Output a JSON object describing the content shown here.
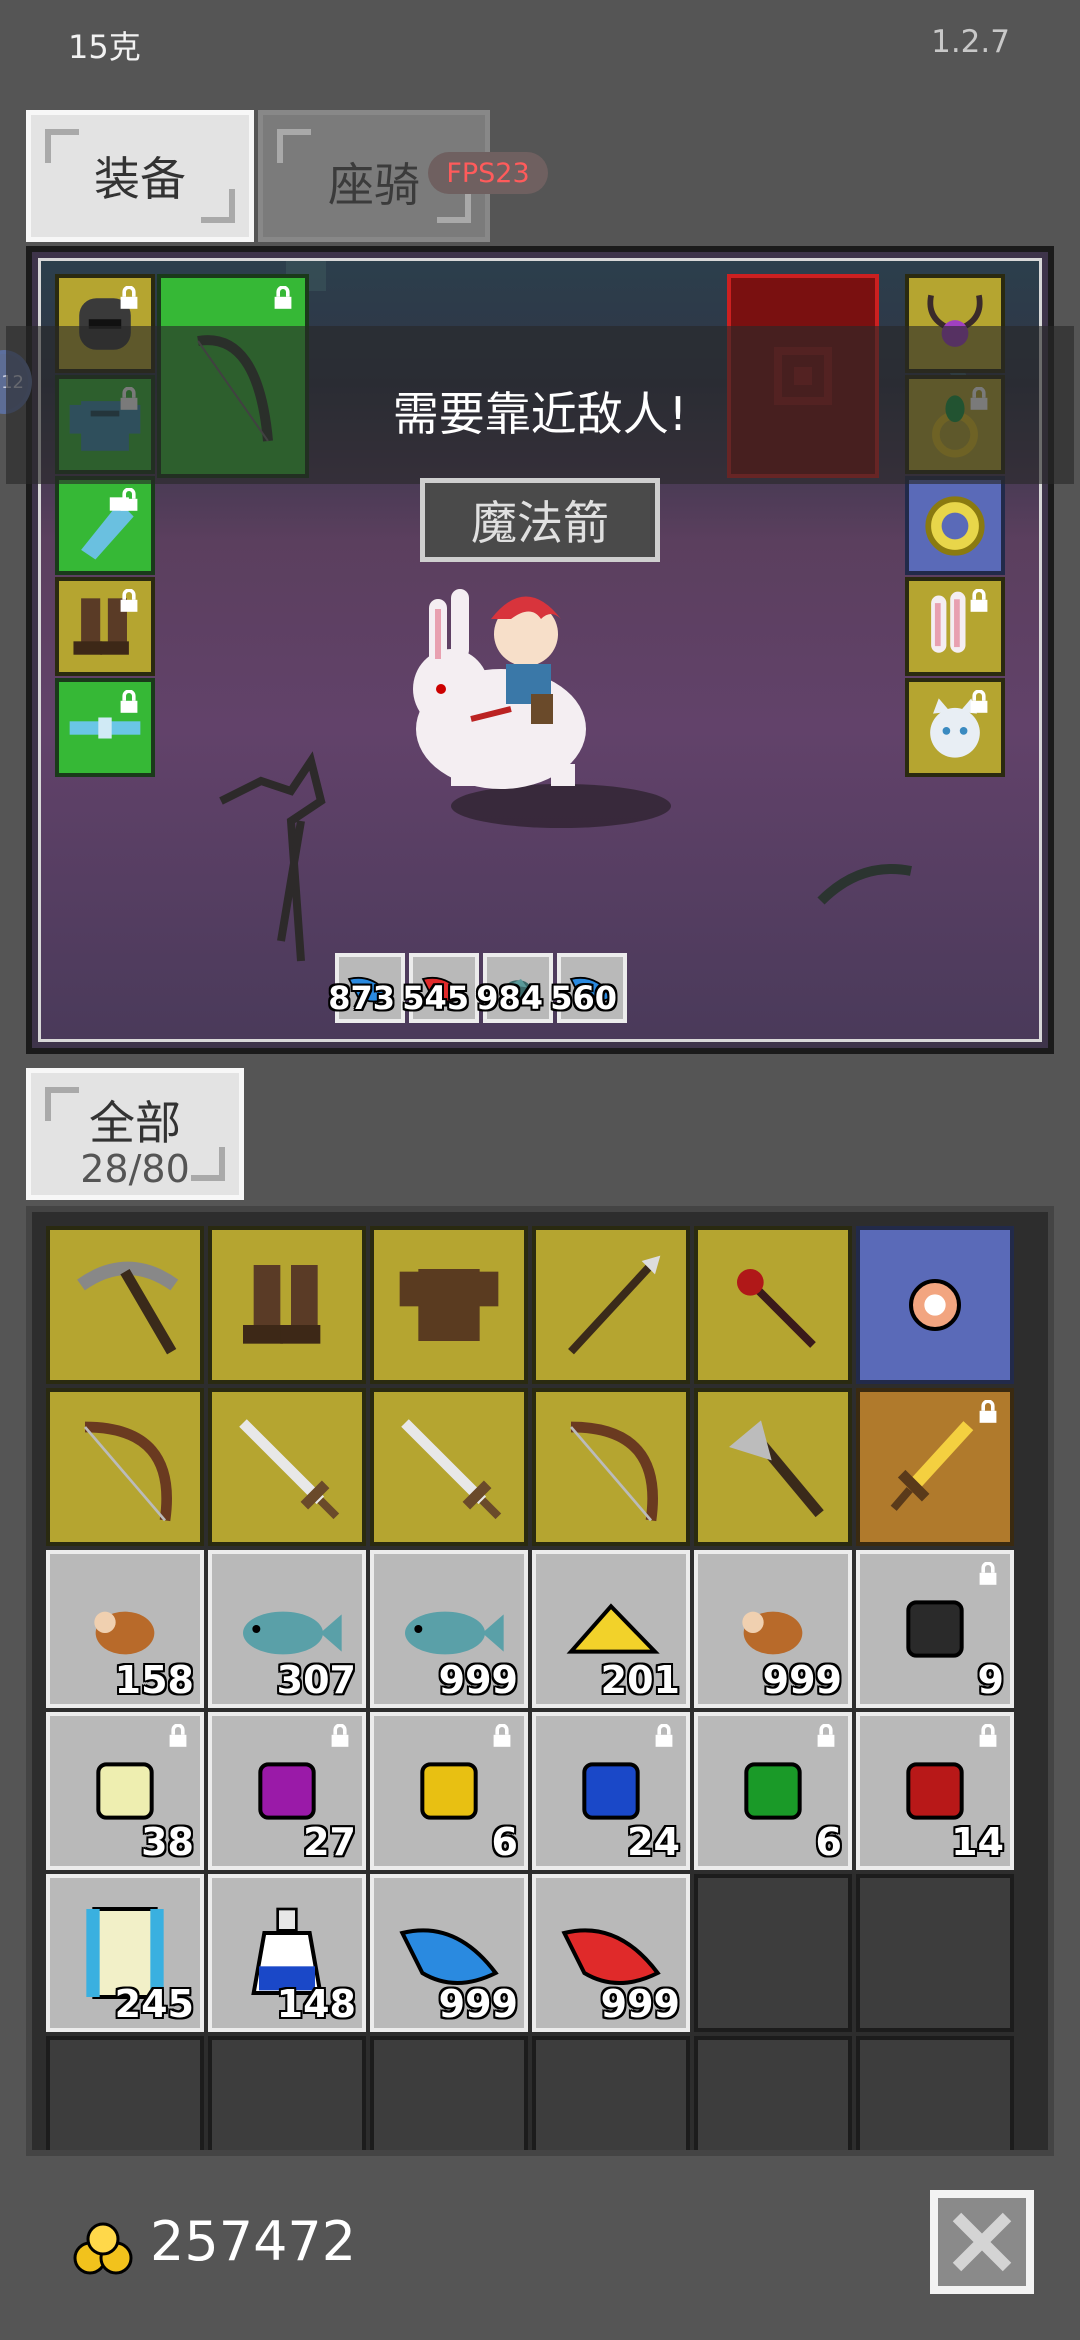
{
  "status": {
    "weight": "15克",
    "version": "1.2.7"
  },
  "tabs": {
    "equipment": "装备",
    "mount": "座骑"
  },
  "fps": "FPS23",
  "side_badge": "12",
  "scene": {
    "message": "需要靠近敌人!",
    "skill_name": "魔法箭",
    "left_slots": [
      {
        "icon": "helmet-icon",
        "color": "y",
        "locked": true
      },
      {
        "icon": "armor-icon",
        "color": "g",
        "locked": true
      },
      {
        "icon": "gauntlet-icon",
        "color": "g",
        "locked": true
      },
      {
        "icon": "boots-icon",
        "color": "y",
        "locked": true
      },
      {
        "icon": "belt-icon",
        "color": "g",
        "locked": true
      }
    ],
    "right_slots": [
      {
        "icon": "horned-amulet-icon",
        "color": "y",
        "locked": false
      },
      {
        "icon": "emerald-ring-icon",
        "color": "y",
        "locked": true
      },
      {
        "icon": "gold-ring-icon",
        "color": "b",
        "locked": false
      },
      {
        "icon": "bunny-ears-icon",
        "color": "y",
        "locked": true
      },
      {
        "icon": "cat-pet-icon",
        "color": "y",
        "locked": true
      }
    ],
    "quick_items": [
      {
        "icon": "blue-feather-icon",
        "count": "873"
      },
      {
        "icon": "red-feather-icon",
        "count": "545"
      },
      {
        "icon": "teal-fish-icon",
        "count": "984"
      },
      {
        "icon": "blue-feather-icon",
        "count": "560"
      }
    ]
  },
  "inventory": {
    "filter_label": "全部",
    "capacity": "28/80",
    "items": [
      {
        "icon": "pickaxe-icon",
        "color": "y",
        "count": "",
        "locked": false
      },
      {
        "icon": "boots-icon",
        "color": "y",
        "count": "",
        "locked": false
      },
      {
        "icon": "leather-armor-icon",
        "color": "y",
        "count": "",
        "locked": false
      },
      {
        "icon": "spear-icon",
        "color": "y",
        "count": "",
        "locked": false
      },
      {
        "icon": "ruby-wand-icon",
        "color": "y",
        "count": "",
        "locked": false
      },
      {
        "icon": "orb-icon",
        "color": "b",
        "count": "",
        "locked": false
      },
      {
        "icon": "bow-icon",
        "color": "y",
        "count": "",
        "locked": false
      },
      {
        "icon": "sword-icon",
        "color": "y",
        "count": "",
        "locked": false
      },
      {
        "icon": "sword-icon",
        "color": "y",
        "count": "",
        "locked": false
      },
      {
        "icon": "bow-icon",
        "color": "y",
        "count": "",
        "locked": false
      },
      {
        "icon": "axe-icon",
        "color": "y",
        "count": "",
        "locked": false
      },
      {
        "icon": "golden-sword-icon",
        "color": "o",
        "count": "",
        "locked": true
      },
      {
        "icon": "meat-icon",
        "color": "gr",
        "count": "158",
        "locked": false
      },
      {
        "icon": "fish-icon",
        "color": "gr",
        "count": "307",
        "locked": false
      },
      {
        "icon": "fish-icon",
        "color": "gr",
        "count": "999",
        "locked": false
      },
      {
        "icon": "cheese-icon",
        "color": "gr",
        "count": "201",
        "locked": false
      },
      {
        "icon": "meat-icon",
        "color": "gr",
        "count": "999",
        "locked": false
      },
      {
        "icon": "coal-icon",
        "color": "gr",
        "count": "9",
        "locked": true
      },
      {
        "icon": "pale-gem-icon",
        "color": "gr",
        "count": "38",
        "locked": true
      },
      {
        "icon": "purple-gem-icon",
        "color": "gr",
        "count": "27",
        "locked": true
      },
      {
        "icon": "yellow-gem-icon",
        "color": "gr",
        "count": "6",
        "locked": true
      },
      {
        "icon": "blue-gem-icon",
        "color": "gr",
        "count": "24",
        "locked": true
      },
      {
        "icon": "green-gem-icon",
        "color": "gr",
        "count": "6",
        "locked": true
      },
      {
        "icon": "red-gem-icon",
        "color": "gr",
        "count": "14",
        "locked": true
      },
      {
        "icon": "scroll-icon",
        "color": "gr",
        "count": "245",
        "locked": false
      },
      {
        "icon": "potion-icon",
        "color": "gr",
        "count": "148",
        "locked": false
      },
      {
        "icon": "blue-feather-icon",
        "color": "gr",
        "count": "999",
        "locked": false
      },
      {
        "icon": "red-feather-icon",
        "color": "gr",
        "count": "999",
        "locked": false
      },
      {
        "icon": "empty-slot-icon",
        "color": "em",
        "count": "",
        "locked": false
      },
      {
        "icon": "empty-slot-icon",
        "color": "em",
        "count": "",
        "locked": false
      },
      {
        "icon": "empty-slot-icon",
        "color": "em",
        "count": "",
        "locked": false
      },
      {
        "icon": "empty-slot-icon",
        "color": "em",
        "count": "",
        "locked": false
      },
      {
        "icon": "empty-slot-icon",
        "color": "em",
        "count": "",
        "locked": false
      },
      {
        "icon": "empty-slot-icon",
        "color": "em",
        "count": "",
        "locked": false
      },
      {
        "icon": "empty-slot-icon",
        "color": "em",
        "count": "",
        "locked": false
      },
      {
        "icon": "empty-slot-icon",
        "color": "em",
        "count": "",
        "locked": false
      }
    ]
  },
  "gold": "257472"
}
